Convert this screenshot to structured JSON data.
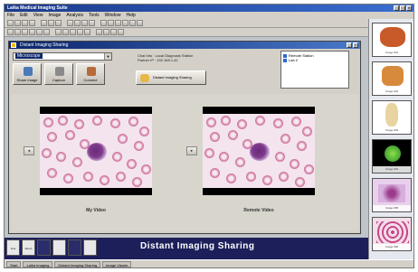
{
  "app": {
    "title": "Laika Medical Imaging Suite",
    "menu": [
      "File",
      "Edit",
      "View",
      "Image",
      "Analysis",
      "Tools",
      "Window",
      "Help"
    ]
  },
  "dialog": {
    "title": "Distant Imaging Sharing",
    "combo_value": "Microscope",
    "buttons": [
      "Share Image",
      "Capture",
      "Connect"
    ],
    "info_lines": [
      "Chat Info : Local Diagnosis Station",
      "Partner IP : 192.168.1.42"
    ],
    "wide_button_label": "Distant Imaging Sharing",
    "list_items": [
      "Remote Station",
      "Lab 2"
    ]
  },
  "images": {
    "left_caption": "My Video",
    "right_caption": "Remote Video",
    "left_arrow": "◄",
    "right_arrow": "►"
  },
  "status": {
    "banner": "Distant Imaging Sharing",
    "cells": [
      "Live",
      "Zoom",
      "",
      "",
      "",
      ""
    ]
  },
  "taskbar": {
    "items": [
      "Start",
      "Laika Imaging",
      "Distant Imaging Sharing",
      "Image Viewer"
    ]
  },
  "thumbnails": {
    "labels": [
      "Image 001",
      "Image 002",
      "Image 003",
      "Image 004",
      "Image 005",
      "Image 006"
    ],
    "colors": [
      "#c85a2a",
      "#d88a3c",
      "#e8d4a0",
      "#2a8a2a",
      "#9a3a8a",
      "#c84a8a"
    ]
  }
}
